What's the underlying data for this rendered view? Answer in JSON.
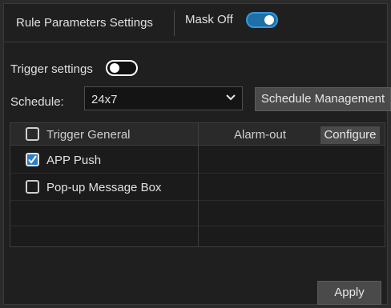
{
  "header": {
    "title": "Rule Parameters Settings",
    "mask_label": "Mask Off",
    "mask_toggle_on": true
  },
  "trigger": {
    "label": "Trigger settings",
    "toggle_on": false
  },
  "schedule": {
    "label": "Schedule:",
    "selected": "24x7",
    "manage_button": "Schedule Management"
  },
  "table": {
    "left_header": "Trigger General",
    "right_header": "Alarm-out",
    "configure_button": "Configure",
    "rows": [
      {
        "label": "APP Push",
        "checked": true
      },
      {
        "label": "Pop-up Message Box",
        "checked": false
      }
    ]
  },
  "footer": {
    "apply_button": "Apply"
  },
  "colors": {
    "accent": "#2d9be0",
    "panel": "#1f1f1f",
    "button": "#4a4a4a"
  }
}
